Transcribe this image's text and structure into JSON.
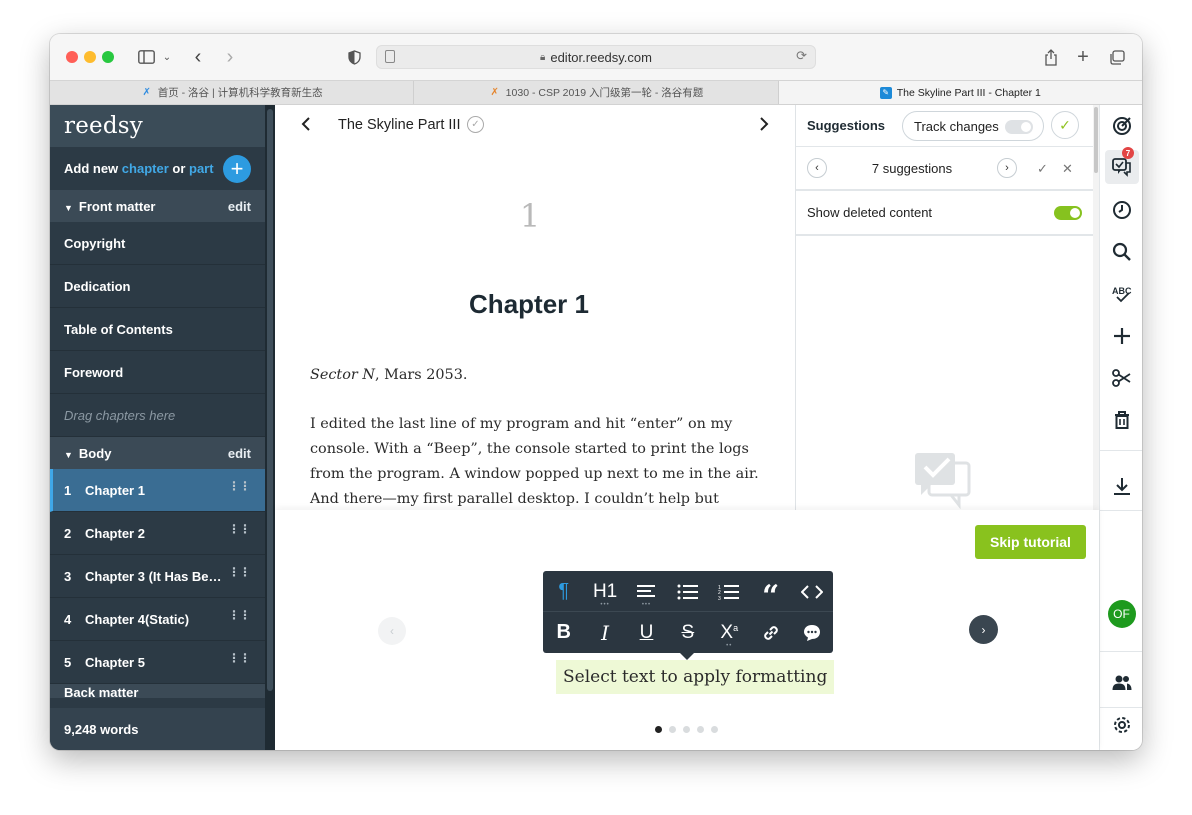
{
  "browser": {
    "url": "editor.reedsy.com",
    "tabs": [
      {
        "label": "首页 - 洛谷 | 计算机科学教育新生态",
        "active": false
      },
      {
        "label": "1030 - CSP 2019 入门级第一轮 - 洛谷有题",
        "active": false
      },
      {
        "label": "The Skyline Part III - Chapter 1",
        "active": true
      }
    ]
  },
  "sidebar": {
    "logo": "reedsy",
    "add_new": {
      "prefix": "Add new",
      "chapter": "chapter",
      "or": "or",
      "part": "part"
    },
    "front_matter": {
      "label": "Front matter",
      "edit": "edit",
      "items": [
        "Copyright",
        "Dedication",
        "Table of Contents",
        "Foreword"
      ],
      "drag_hint": "Drag chapters here"
    },
    "body": {
      "label": "Body",
      "edit": "edit",
      "chapters": [
        {
          "num": "1",
          "title": "Chapter 1",
          "active": true
        },
        {
          "num": "2",
          "title": "Chapter 2"
        },
        {
          "num": "3",
          "title": "Chapter 3 (It Has Begun)"
        },
        {
          "num": "4",
          "title": "Chapter 4(Static)"
        },
        {
          "num": "5",
          "title": "Chapter 5"
        }
      ]
    },
    "next_section": "Back matter",
    "word_count": "9,248 words"
  },
  "editor": {
    "book_title": "The Skyline Part III",
    "chapter_number": "1",
    "chapter_title": "Chapter 1",
    "p1_italic": "Sector N",
    "p1_rest": ", Mars 2053.",
    "p2": "I edited the last line of my program and hit “enter” on my console. With a “Beep”, the console started to print the logs from the program. A window popped up next to me in the air. And there—my first parallel desktop. I couldn’t help but laugh."
  },
  "suggestions": {
    "title": "Suggestions",
    "track_changes": "Track changes",
    "track_changes_on": false,
    "count_label": "7 suggestions",
    "show_deleted": "Show deleted content",
    "show_deleted_on": true
  },
  "rail": {
    "badge": "7",
    "avatar": "OF",
    "icons": [
      "goals-icon",
      "suggestions-icon",
      "history-icon",
      "search-icon",
      "spellcheck-icon",
      "add-icon",
      "cut-icon",
      "trash-icon",
      "download-icon",
      "users-icon",
      "settings-icon"
    ]
  },
  "tutorial": {
    "skip": "Skip tutorial",
    "hint": "Select text to apply formatting",
    "pages": 5,
    "current_page": 1,
    "toolbar_row1": [
      "¶",
      "H1",
      "align",
      "bullets",
      "numbered",
      "quote",
      "code"
    ],
    "toolbar_row2": [
      "B",
      "I",
      "U",
      "S",
      "X",
      "link",
      "comment"
    ]
  },
  "colors": {
    "sidebar_bg": "#2c3a45",
    "active_chapter": "#3a6d93",
    "accent_blue": "#2d9be0",
    "accent_green": "#89c21e",
    "toolbar_bg": "#2b3640"
  }
}
